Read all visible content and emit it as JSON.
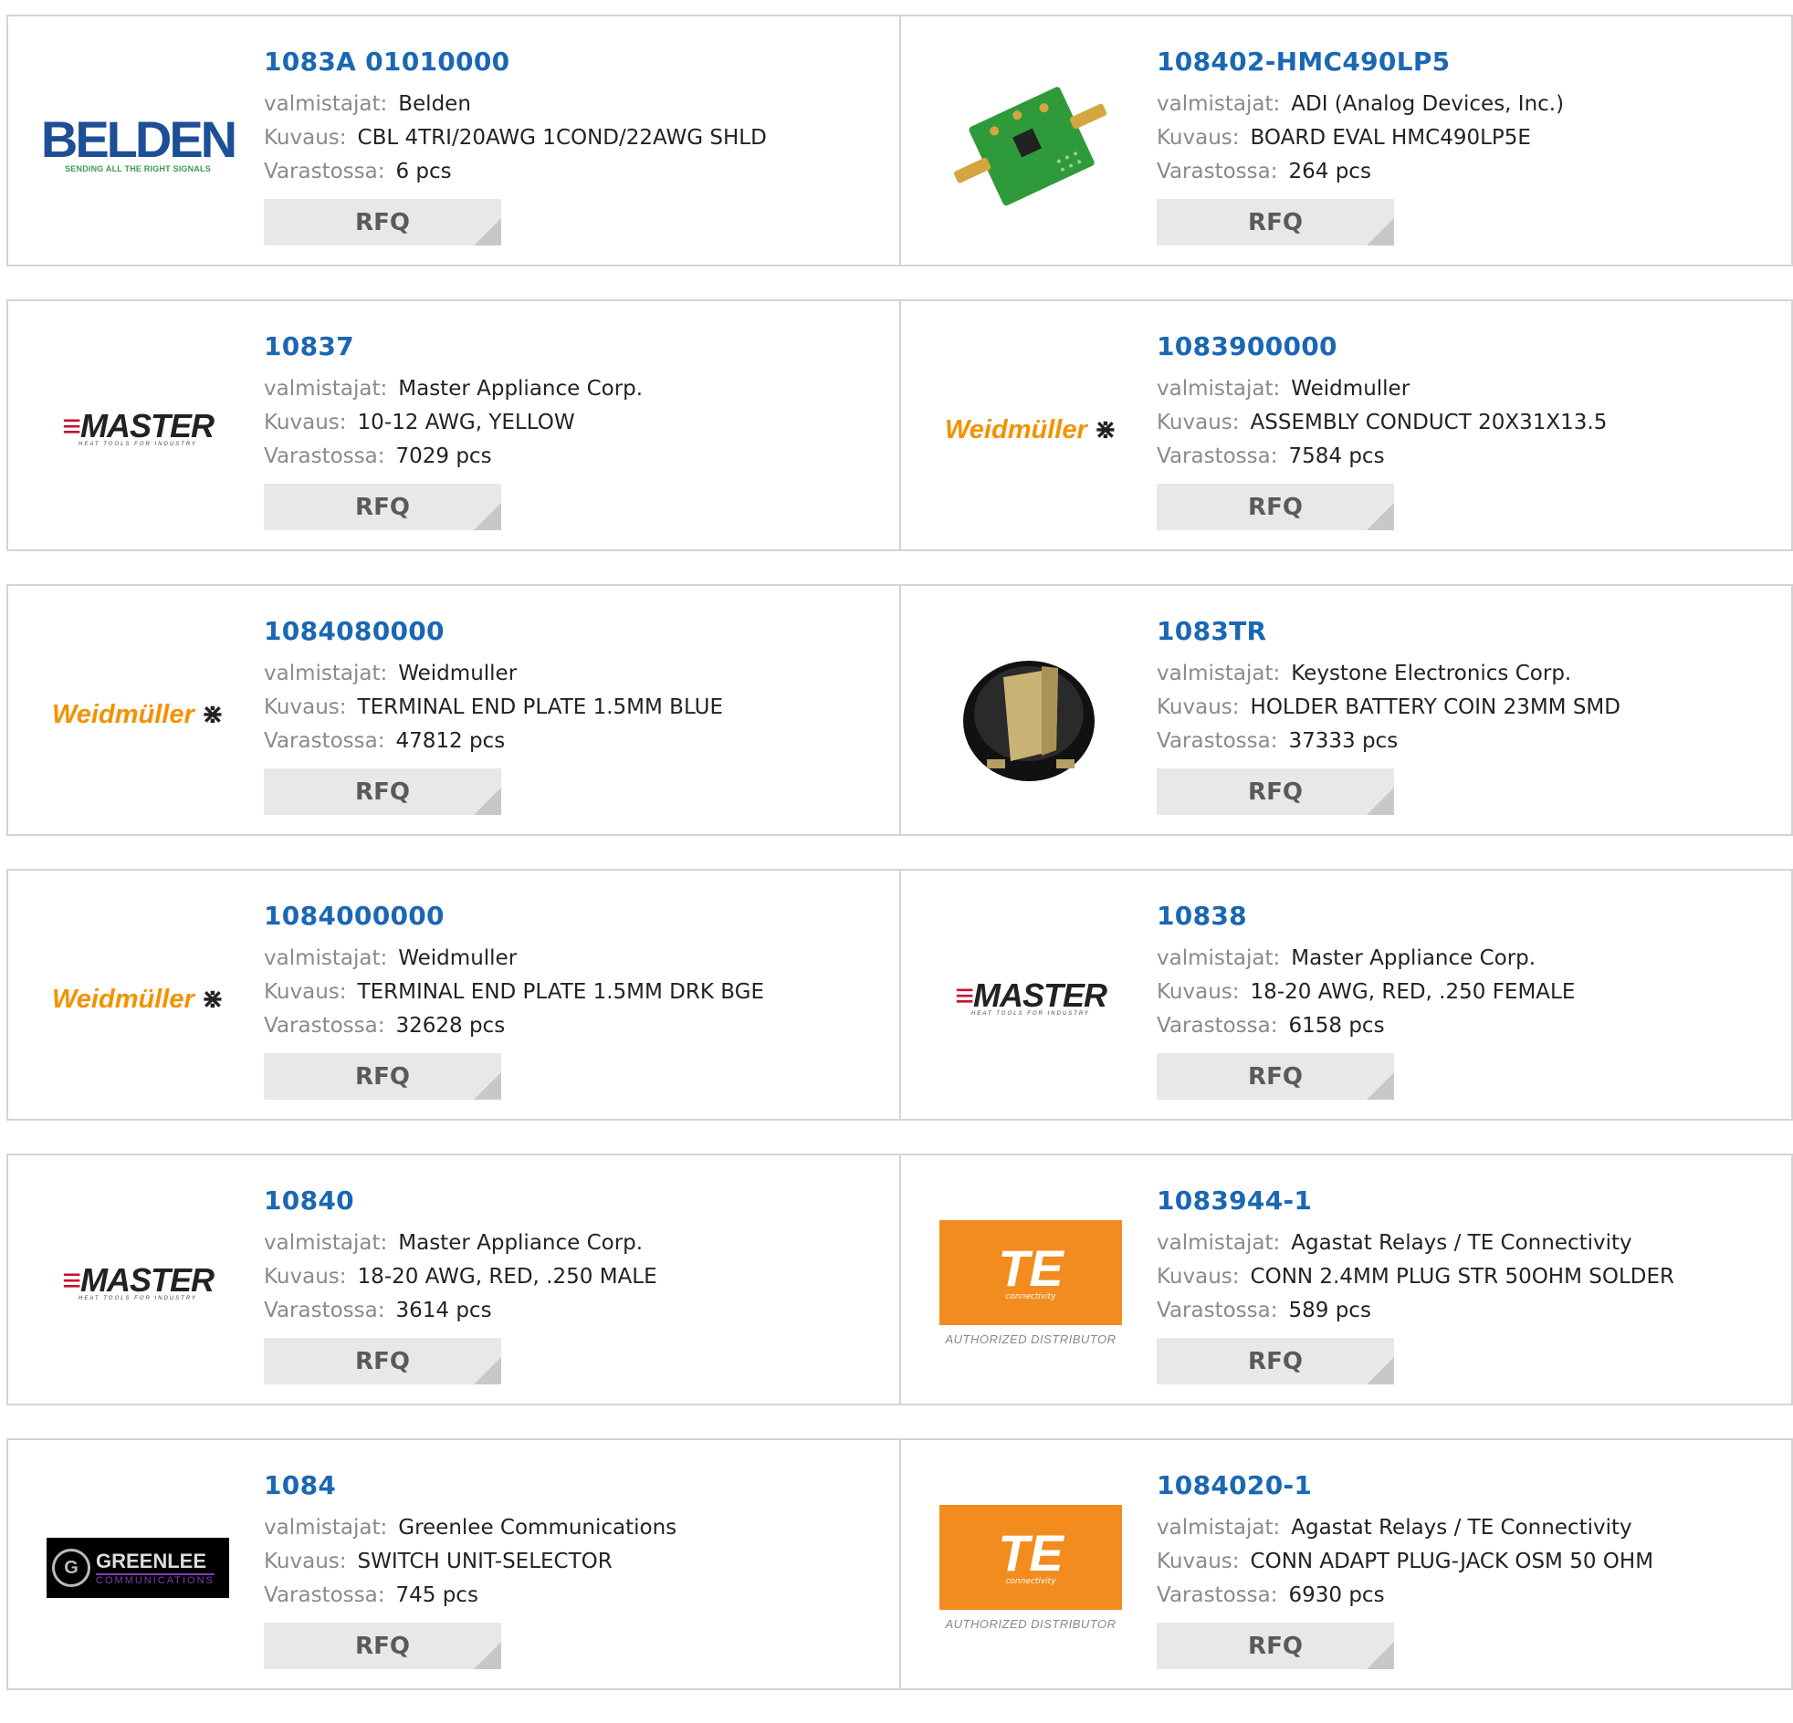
{
  "labels": {
    "manufacturer": "valmistajat:",
    "description": "Kuvaus:",
    "stock": "Varastossa:",
    "rfq": "RFQ"
  },
  "logos": {
    "belden": {
      "name": "BELDEN",
      "tagline": "SENDING ALL THE RIGHT SIGNALS"
    },
    "master": {
      "name": "MASTER",
      "tagline": "HEAT TOOLS FOR INDUSTRY"
    },
    "weidmuller": {
      "name": "Weidmüller"
    },
    "te": {
      "name": "TE",
      "tagline": "connectivity",
      "badge": "AUTHORIZED DISTRIBUTOR"
    },
    "greenlee": {
      "name": "GREENLEE",
      "tagline": "COMMUNICATIONS"
    }
  },
  "products": [
    {
      "part": "1083A 01010000",
      "manufacturer": "Belden",
      "description": "CBL 4TRI/20AWG 1COND/22AWG SHLD",
      "stock": "6 pcs",
      "logo": "belden"
    },
    {
      "part": "108402-HMC490LP5",
      "manufacturer": "ADI (Analog Devices, Inc.)",
      "description": "BOARD EVAL HMC490LP5E",
      "stock": "264 pcs",
      "logo": "pcb-board-image"
    },
    {
      "part": "10837",
      "manufacturer": "Master Appliance Corp.",
      "description": "10-12 AWG, YELLOW",
      "stock": "7029 pcs",
      "logo": "master"
    },
    {
      "part": "1083900000",
      "manufacturer": "Weidmuller",
      "description": "ASSEMBLY CONDUCT 20X31X13.5",
      "stock": "7584 pcs",
      "logo": "weidmuller"
    },
    {
      "part": "1084080000",
      "manufacturer": "Weidmuller",
      "description": "TERMINAL END PLATE 1.5MM BLUE",
      "stock": "47812 pcs",
      "logo": "weidmuller"
    },
    {
      "part": "1083TR",
      "manufacturer": "Keystone Electronics Corp.",
      "description": "HOLDER BATTERY COIN 23MM SMD",
      "stock": "37333 pcs",
      "logo": "battery-holder-image"
    },
    {
      "part": "1084000000",
      "manufacturer": "Weidmuller",
      "description": "TERMINAL END PLATE 1.5MM DRK BGE",
      "stock": "32628 pcs",
      "logo": "weidmuller"
    },
    {
      "part": "10838",
      "manufacturer": "Master Appliance Corp.",
      "description": "18-20 AWG, RED, .250 FEMALE",
      "stock": "6158 pcs",
      "logo": "master"
    },
    {
      "part": "10840",
      "manufacturer": "Master Appliance Corp.",
      "description": "18-20 AWG, RED, .250 MALE",
      "stock": "3614 pcs",
      "logo": "master"
    },
    {
      "part": "1083944-1",
      "manufacturer": "Agastat Relays / TE Connectivity",
      "description": "CONN 2.4MM PLUG STR 50OHM SOLDER",
      "stock": "589 pcs",
      "logo": "te"
    },
    {
      "part": "1084",
      "manufacturer": "Greenlee Communications",
      "description": "SWITCH UNIT-SELECTOR",
      "stock": "745 pcs",
      "logo": "greenlee"
    },
    {
      "part": "1084020-1",
      "manufacturer": "Agastat Relays / TE Connectivity",
      "description": "CONN ADAPT PLUG-JACK OSM 50 OHM",
      "stock": "6930 pcs",
      "logo": "te"
    }
  ]
}
